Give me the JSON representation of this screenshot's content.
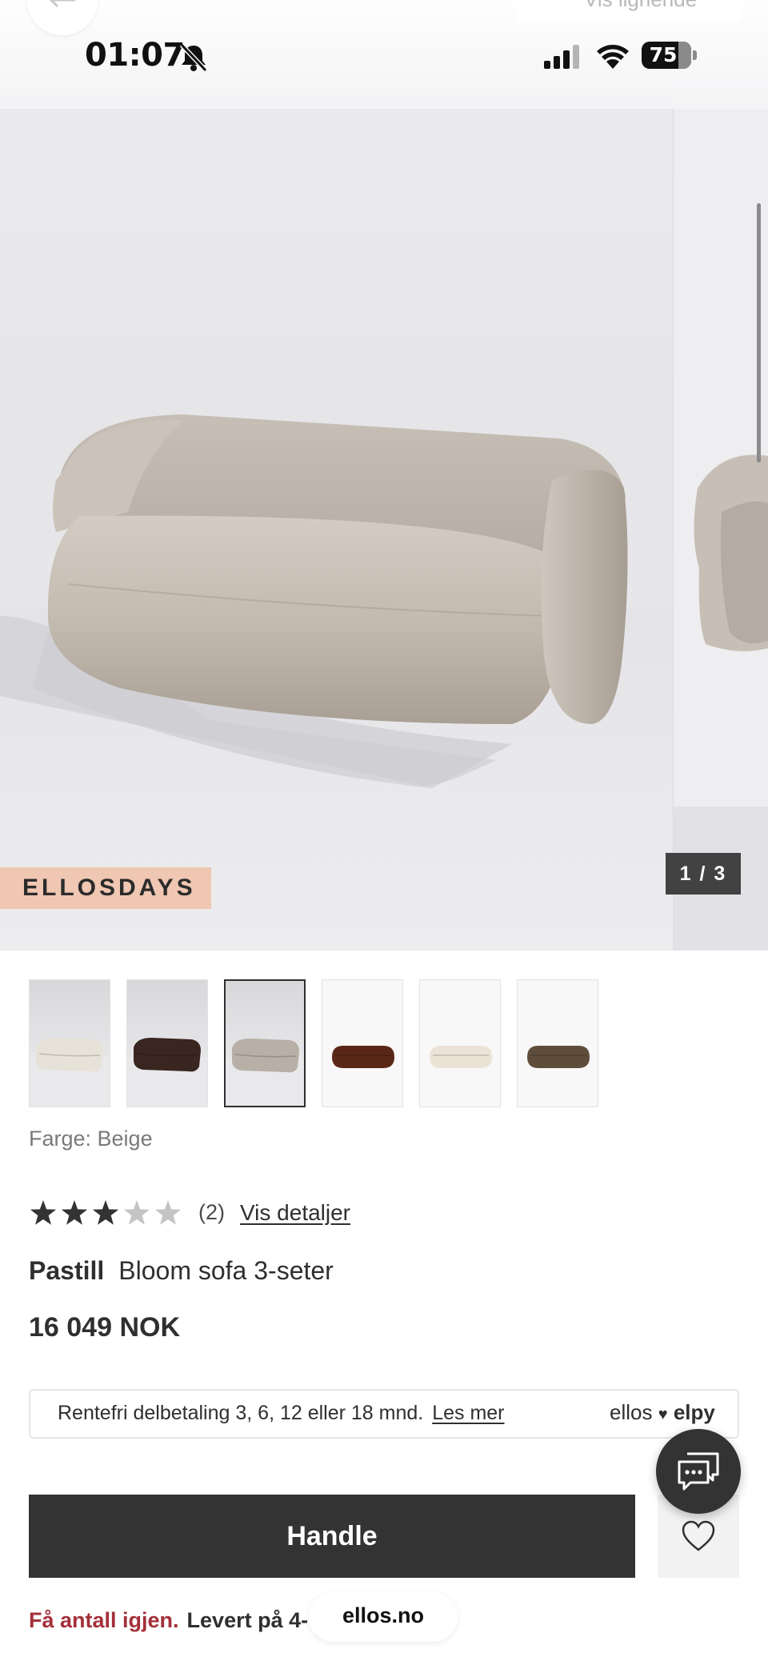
{
  "status_bar": {
    "time": "01:07",
    "battery": "75"
  },
  "top_bar": {
    "similar_label": "Vis lignende"
  },
  "gallery": {
    "badge": "ELLOSDAYS",
    "counter": "1 / 3"
  },
  "swatches": [
    {
      "name": "Off-white",
      "style": "studio",
      "sofa_color": "#e7e2d8"
    },
    {
      "name": "Brown",
      "style": "studio",
      "sofa_color": "#3a2620"
    },
    {
      "name": "Beige",
      "style": "studio",
      "sofa_color": "#b8afa6",
      "selected": true
    },
    {
      "name": "Rust brown",
      "style": "white",
      "sofa_color": "#5a2716"
    },
    {
      "name": "Cream",
      "style": "white",
      "sofa_color": "#ebe3d6"
    },
    {
      "name": "Olive brown",
      "style": "white",
      "sofa_color": "#5d4d3a"
    }
  ],
  "product": {
    "color_label": "Farge: Beige",
    "rating": {
      "value": 3,
      "max": 5,
      "count": "(2)",
      "link": "Vis detaljer"
    },
    "brand": "Pastill",
    "name": "Bloom sofa 3-seter",
    "price": "16 049 NOK"
  },
  "payment": {
    "text": "Rentefri delbetaling 3, 6, 12 eller 18 mnd.",
    "link": "Les mer",
    "logo_ellos": "ellos",
    "logo_heart": "♥",
    "logo_elpy": "elpy"
  },
  "actions": {
    "buy_label": "Handle"
  },
  "delivery": {
    "warning": "Få antall igjen.",
    "text": "Levert på 4-"
  },
  "browser": {
    "url": "ellos.no"
  },
  "colors": {
    "button_dark": "#333333",
    "badge": "#f0c7b2",
    "warning_red": "#a3303a",
    "star_filled": "#333333",
    "star_empty": "#c4c4c4"
  }
}
